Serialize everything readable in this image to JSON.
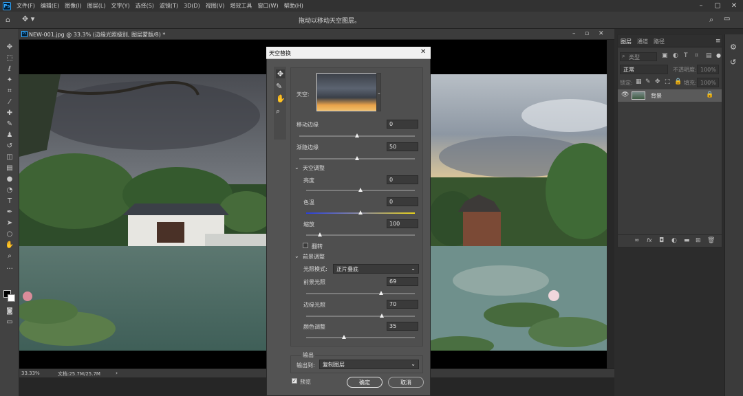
{
  "menubar": {
    "items": [
      "文件(F)",
      "编辑(E)",
      "图像(I)",
      "图层(L)",
      "文字(Y)",
      "选择(S)",
      "滤镜(T)",
      "3D(D)",
      "视图(V)",
      "增效工具",
      "窗口(W)",
      "帮助(H)"
    ]
  },
  "optionsbar": {
    "hint": "拖动以移动天空图层。"
  },
  "document": {
    "tab_title": "NEW-001.jpg @ 33.3% (边缘光照级别, 图层蒙版/8) *",
    "zoom": "33.33%",
    "doc_size": "文档:25.7M/25.7M"
  },
  "dialog": {
    "title": "天空替换",
    "sky_label": "天空:",
    "shift_edge": {
      "label": "移动边缘",
      "value": "0",
      "level": 0.5
    },
    "fade_edge": {
      "label": "渐隐边缘",
      "value": "50",
      "level": 0.5
    },
    "sky_adjust": {
      "header": "天空调整"
    },
    "brightness": {
      "label": "亮度",
      "value": "0",
      "level": 0.5
    },
    "temperature": {
      "label": "色温",
      "value": "0",
      "level": 0.5
    },
    "scale": {
      "label": "缩放",
      "value": "100",
      "level": 0.13
    },
    "flip": {
      "label": "翻转",
      "checked": false
    },
    "fg_adjust": {
      "header": "前景调整"
    },
    "lighting_mode": {
      "label": "光照模式:",
      "value": "正片叠底"
    },
    "fg_lighting": {
      "label": "前景光照",
      "value": "69",
      "level": 0.69
    },
    "edge_lighting": {
      "label": "边缘光照",
      "value": "70",
      "level": 0.7
    },
    "color_adjust": {
      "label": "颜色调整",
      "value": "35",
      "level": 0.35
    },
    "output": {
      "header": "输出",
      "label": "输出到:",
      "value": "复制图层"
    },
    "preview": {
      "label": "预览",
      "checked": true
    },
    "ok": "确定",
    "cancel": "取消"
  },
  "layers_panel": {
    "tabs": [
      "图层",
      "通道",
      "路径"
    ],
    "search_placeholder": "类型",
    "blend_mode": "正常",
    "opacity_label": "不透明度:",
    "opacity_value": "100%",
    "lock_label": "锁定:",
    "fill_label": "填充:",
    "fill_value": "100%",
    "layer_name": "背景"
  },
  "colors": {
    "accent": "#31a8ff",
    "dialog_bg": "#535353",
    "panel_bg": "#3b3b3b"
  }
}
